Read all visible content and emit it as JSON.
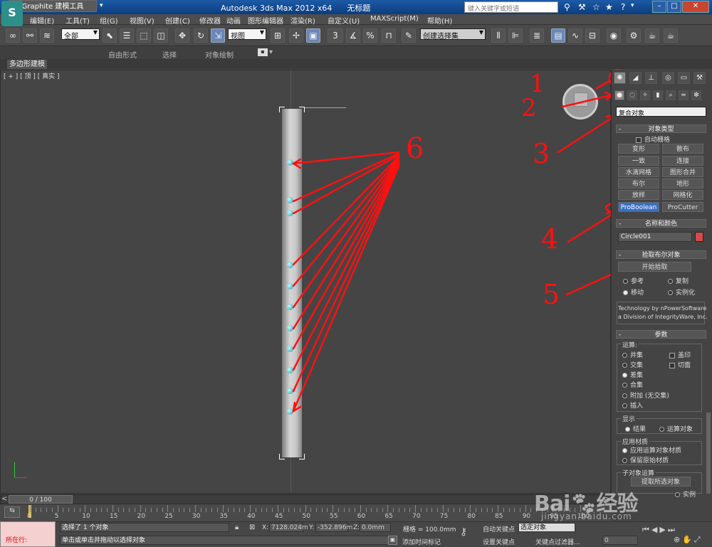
{
  "title": {
    "app": "Autodesk 3ds Max  2012 x64",
    "file": "无标题",
    "search_placeholder": "键入关键字或短语"
  },
  "menu": [
    "编辑(E)",
    "工具(T)",
    "组(G)",
    "视图(V)",
    "创建(C)",
    "修改器",
    "动画",
    "图形编辑器",
    "渲染(R)",
    "自定义(U)",
    "MAXScript(M)",
    "帮助(H)"
  ],
  "toolbar": {
    "selection_filter": "全部",
    "reference_coord": "视图",
    "named_selection": "创建选择集",
    "snap_label": "3",
    "percent_label": "%"
  },
  "ribbon": {
    "tabs": [
      "Graphite 建模工具",
      "自由形式",
      "选择",
      "对象绘制"
    ],
    "subtab": "多边形建模"
  },
  "viewport": {
    "label": "[ + ] [ 顶 ] [ 真实 ]",
    "annotations": [
      "1",
      "2",
      "3",
      "4",
      "5",
      "6"
    ]
  },
  "command_panel": {
    "category": "复合对象",
    "object_type": {
      "header": "对象类型",
      "autogrid": "自动栅格",
      "buttons": [
        "变形",
        "散布",
        "一致",
        "连接",
        "水滴网格",
        "图形合并",
        "布尔",
        "地形",
        "放样",
        "网格化",
        "ProBoolean",
        "ProCutter"
      ],
      "selected": "ProBoolean"
    },
    "name_color": {
      "header": "名称和颜色",
      "name": "Circle001",
      "color": "#d64a4a"
    },
    "pick_boolean": {
      "header": "拾取布尔对象",
      "start_pick": "开始拾取",
      "options": [
        "参考",
        "复制",
        "移动",
        "实例化"
      ],
      "selected": "移动",
      "credit_line1": "Technology by nPowerSoftware",
      "credit_line2": "a Division of IntegrityWare, Inc."
    },
    "params": {
      "header": "参数",
      "op_label": "运算:",
      "ops": [
        "并集",
        "交集",
        "差集",
        "合集",
        "附加 (无交集)",
        "插入"
      ],
      "op_selected": "差集",
      "checks": [
        "盖印",
        "切面"
      ],
      "display_label": "显示",
      "display_opts": [
        "结果",
        "运算对象"
      ],
      "display_selected": "结果",
      "material_label": "应用材质",
      "material_opts": [
        "应用运算对象材质",
        "保留原始材质"
      ],
      "material_selected": "应用运算对象材质",
      "subobj_label": "子对象运算",
      "extract_button": "提取所选对象",
      "instance_label": "实例"
    }
  },
  "timeline": {
    "position": "0 / 100",
    "ticks": [
      "0",
      "5",
      "10",
      "15",
      "20",
      "25",
      "30",
      "35",
      "40",
      "45",
      "50",
      "55",
      "60",
      "65",
      "70",
      "75",
      "80",
      "85",
      "90",
      "95",
      "100"
    ]
  },
  "status": {
    "selected_text": "选择了 1 个对象",
    "prompt_text": "单击或单击并拖动以选择对象",
    "running_label": "所在行:",
    "x_label": "X:",
    "x_value": "7128.024m",
    "y_label": "Y:",
    "y_value": "-352.896m",
    "z_label": "Z:",
    "z_value": "0.0mm",
    "grid_label": "栅格 = 100.0mm",
    "add_time_tag": "添加时间标记",
    "autokey_label": "自动关键点",
    "autokey_value": "选定对象",
    "setkey_label": "设置关键点",
    "key_filter": "关键点过滤器...",
    "frame_value": "0"
  },
  "watermark": {
    "brand": "Bai",
    "brand2": "经验",
    "sub": "jingyan.baidu.com"
  },
  "colors": {
    "annotation": "#ff1010",
    "selected_button": "#3a6fc0"
  }
}
